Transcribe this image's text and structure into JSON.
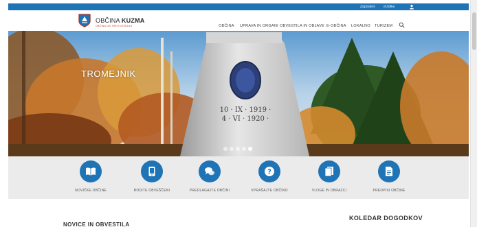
{
  "topbar": {
    "links": [
      "Zaposleni",
      "eUslike"
    ],
    "user_icon": "user-icon",
    "color": "#1f74b6"
  },
  "logo": {
    "prefix": "OBČINA",
    "name": "KUZMA",
    "subtitle": "OBČINA OB TREH DEŽELAH",
    "crest_icon": "crest-icon"
  },
  "nav": {
    "items": [
      "OBČINA",
      "UPRAVA IN ORGANI",
      "OBVESTILA IN OBJAVE",
      "E-OBČINA",
      "LOKALNO",
      "TURIZEM"
    ],
    "search_icon": "search-icon"
  },
  "hero": {
    "title": "TROMEJNIK",
    "monument_text_line1": "10 · IX · 1919 ·",
    "monument_text_line2": "4 · VI · 1920 ·",
    "slides": 5,
    "active_slide": 5
  },
  "services": [
    {
      "label": "NOVIČKE OBČINE",
      "icon": "book-icon"
    },
    {
      "label": "BODITE OBVEŠČENI",
      "icon": "mobile-icon"
    },
    {
      "label": "PREDLAGAJTE OBČINI",
      "icon": "chat-icon"
    },
    {
      "label": "VPRAŠAJTE OBČINO",
      "icon": "question-icon"
    },
    {
      "label": "VLOGE IN OBRAZCI",
      "icon": "forms-icon"
    },
    {
      "label": "PREDPISI OBČINE",
      "icon": "document-icon"
    }
  ],
  "sections": {
    "news_title": "NOVICE IN OBVESTILA",
    "calendar_title": "KOLEDAR DOGODKOV"
  },
  "colors": {
    "accent": "#1f74b6",
    "services_bg": "#ebebeb",
    "logo_red": "#c0392b"
  }
}
